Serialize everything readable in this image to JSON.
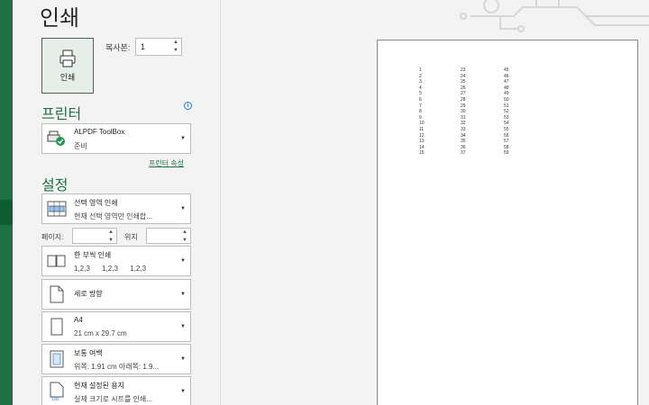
{
  "title": "인쇄",
  "print_button": {
    "label": "인쇄"
  },
  "copies": {
    "label": "복사본:",
    "value": "1"
  },
  "printer": {
    "heading": "프린터",
    "name": "ALPDF ToolBox",
    "status": "준비",
    "properties_link": "프린터 속성"
  },
  "settings": {
    "heading": "설정",
    "print_what": {
      "line1": "선택 영역 인쇄",
      "line2": "현재 선택 영역만 인쇄합..."
    },
    "pages_label": "페이지:",
    "to_label": "위치",
    "sides": {
      "line1": "한 부씩 인쇄",
      "line2": "1,2,3      1,2,3      1,2,3"
    },
    "orientation": {
      "line1": "세로 방향"
    },
    "paper": {
      "line1": "A4",
      "line2": "21 cm x 29.7 cm"
    },
    "margins": {
      "line1": "보통 여백",
      "line2": "위쪽: 1.91 cm 아래쪽: 1.9..."
    },
    "scaling": {
      "line1": "현재 설정된 용지",
      "line2": "실제 크기로 시트를 인쇄..."
    }
  },
  "preview": {
    "col1": [
      "1",
      "2",
      "3",
      "4",
      "5",
      "6",
      "7",
      "8",
      "9",
      "10",
      "11",
      "12",
      "13",
      "14",
      "15"
    ],
    "col2": [
      "23",
      "24",
      "25",
      "26",
      "27",
      "28",
      "29",
      "30",
      "31",
      "32",
      "33",
      "34",
      "35",
      "36",
      "37"
    ],
    "col3": [
      "45",
      "46",
      "47",
      "48",
      "49",
      "50",
      "51",
      "52",
      "53",
      "54",
      "55",
      "56",
      "57",
      "58",
      "59"
    ]
  },
  "colors": {
    "accent": "#1e7145",
    "info": "#2b7cd3"
  }
}
